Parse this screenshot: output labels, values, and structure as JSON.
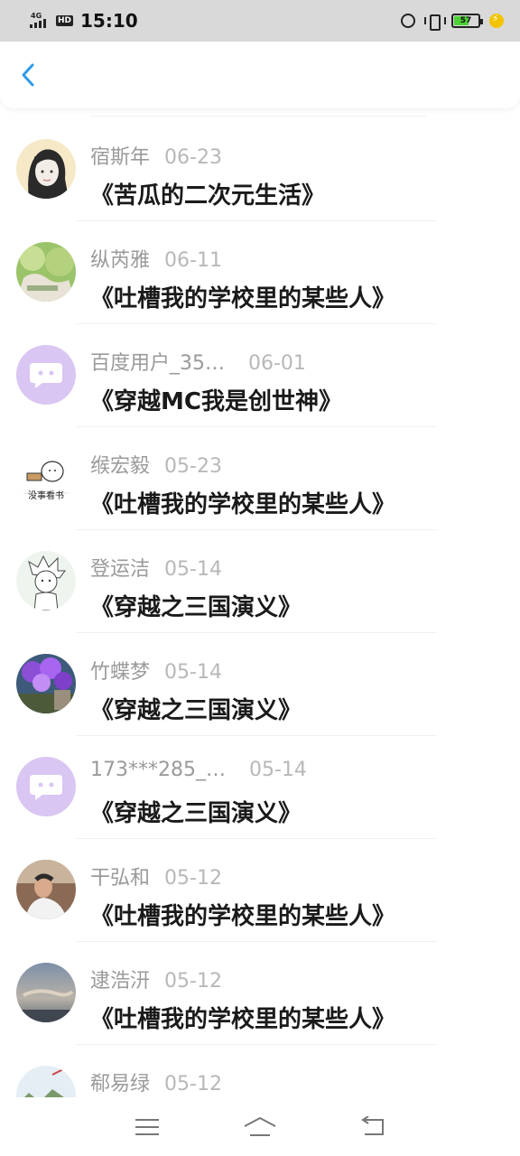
{
  "status_bar": {
    "network": "4G",
    "hd": "HD",
    "time": "15:10",
    "battery": "57",
    "icons": [
      "signal-icon",
      "alarm-icon",
      "vibrate-icon",
      "battery-icon",
      "charging-icon"
    ]
  },
  "header": {
    "back_icon": "chevron-left-icon",
    "accent_color": "#2f9ae6"
  },
  "items": [
    {
      "name": "宿斯年",
      "date": "06-23",
      "book": "《苦瓜的二次元生活》",
      "avatar": "anime-girl"
    },
    {
      "name": "纵芮雅",
      "date": "06-11",
      "book": "《吐槽我的学校里的某些人》",
      "avatar": "green-photo"
    },
    {
      "name": "百度用户_35…",
      "date": "06-01",
      "book": "《穿越MC我是创世神》",
      "avatar": "default"
    },
    {
      "name": "缑宏毅",
      "date": "05-23",
      "book": "《吐槽我的学校里的某些人》",
      "avatar": "sketch-reading"
    },
    {
      "name": "登运洁",
      "date": "05-14",
      "book": "《穿越之三国演义》",
      "avatar": "sketch-boy"
    },
    {
      "name": "竹蝶梦",
      "date": "05-14",
      "book": "《穿越之三国演义》",
      "avatar": "purple-flowers"
    },
    {
      "name": "173***285_…",
      "date": "05-14",
      "book": "《穿越之三国演义》",
      "avatar": "default"
    },
    {
      "name": "干弘和",
      "date": "05-12",
      "book": "《吐槽我的学校里的某些人》",
      "avatar": "selfie"
    },
    {
      "name": "逮浩汧",
      "date": "05-12",
      "book": "《吐槽我的学校里的某些人》",
      "avatar": "sky"
    },
    {
      "name": "郗易绿",
      "date": "05-12",
      "book": "",
      "avatar": "landscape"
    }
  ],
  "bottom_nav": {
    "icons": [
      "menu-icon",
      "home-icon",
      "back-icon"
    ]
  },
  "colors": {
    "default_avatar_bg": "#d9c6f2",
    "name_color": "#9a9a9a",
    "date_color": "#b8b8b8",
    "title_color": "#1a1a1a"
  }
}
